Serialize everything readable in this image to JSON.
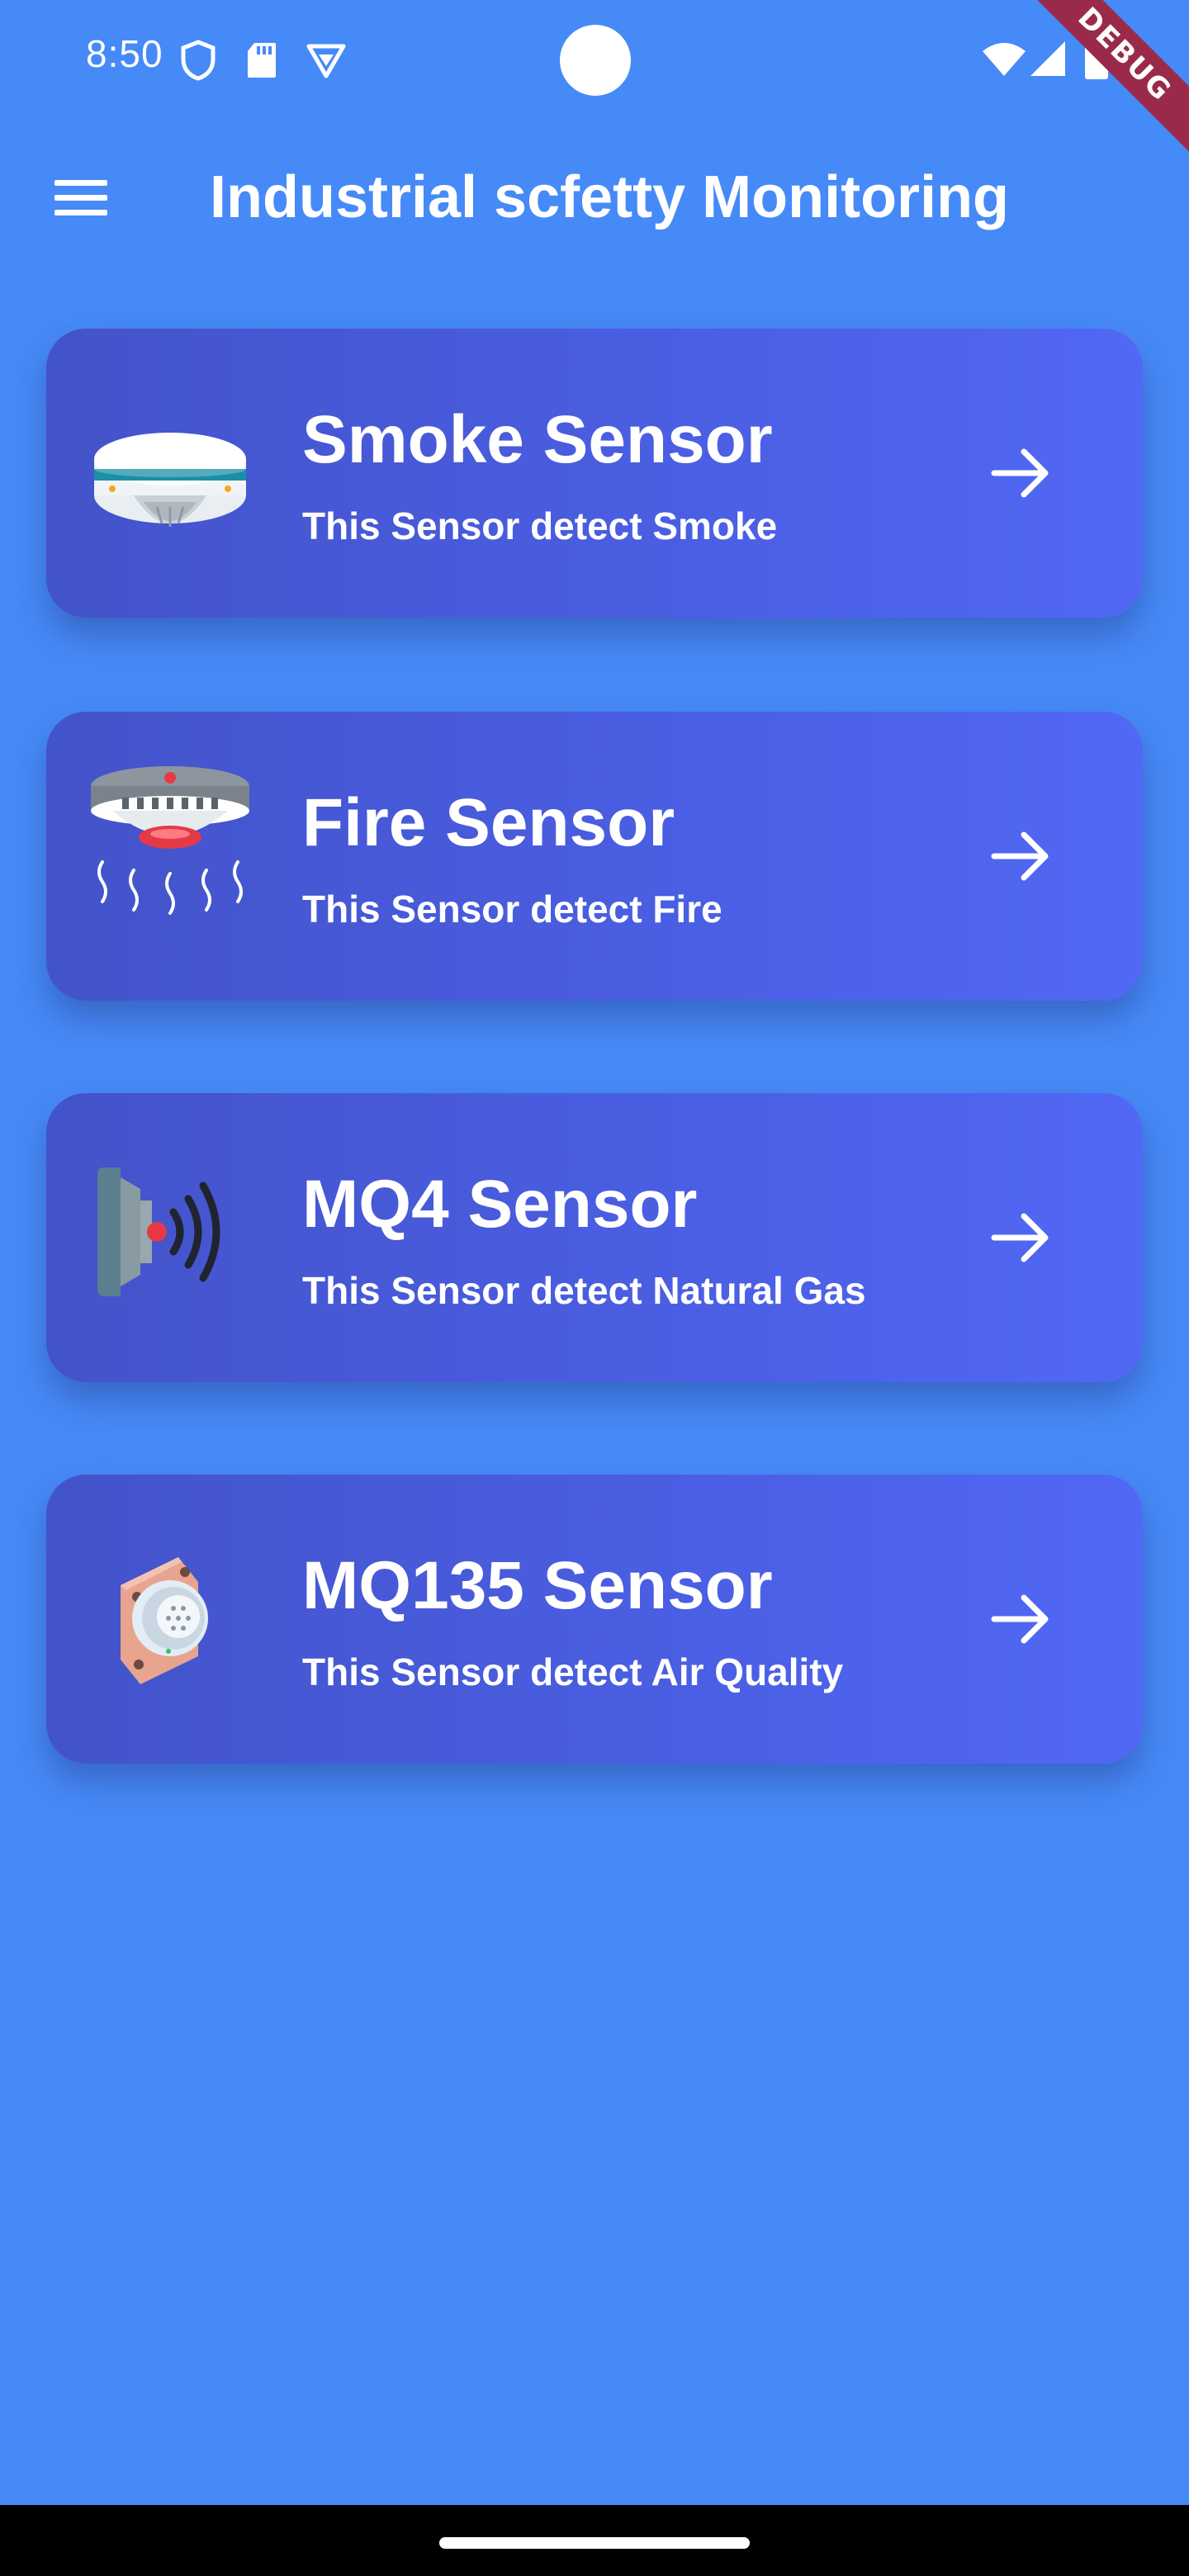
{
  "status_bar": {
    "time": "8:50",
    "icons": [
      "shield-icon",
      "sd-card-icon",
      "vpn-icon",
      "wifi-icon",
      "signal-icon",
      "battery-icon"
    ]
  },
  "debug_banner": "DEBUG",
  "app_bar": {
    "menu_icon": "hamburger-menu-icon",
    "title": "Industrial scfetty Monitoring"
  },
  "colors": {
    "background": "#468af7",
    "card_gradient_start": "#4353c9",
    "card_gradient_end": "#5168f5",
    "text": "#ffffff"
  },
  "sensors": [
    {
      "title": "Smoke Sensor",
      "subtitle": "This Sensor detect Smoke",
      "icon": "smoke-detector-icon",
      "action_icon": "arrow-right-icon"
    },
    {
      "title": "Fire Sensor",
      "subtitle": "This Sensor detect Fire",
      "icon": "fire-detector-icon",
      "action_icon": "arrow-right-icon"
    },
    {
      "title": "MQ4 Sensor",
      "subtitle": "This Sensor detect Natural Gas",
      "icon": "gas-sensor-icon",
      "action_icon": "arrow-right-icon"
    },
    {
      "title": "MQ135 Sensor",
      "subtitle": "This Sensor detect Air Quality",
      "icon": "air-quality-sensor-icon",
      "action_icon": "arrow-right-icon"
    }
  ]
}
